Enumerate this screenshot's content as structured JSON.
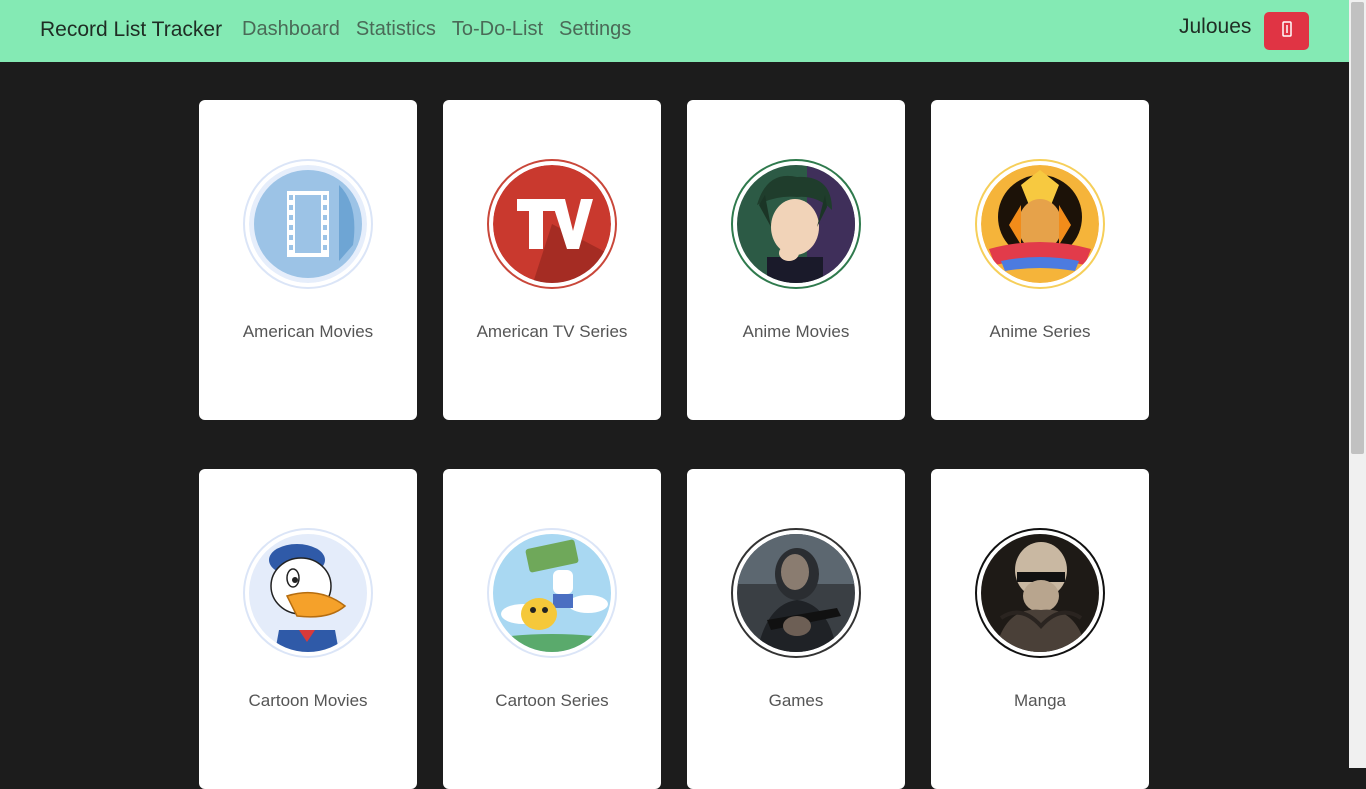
{
  "navbar": {
    "brand": "Record List Tracker",
    "links": [
      "Dashboard",
      "Statistics",
      "To-Do-List",
      "Settings"
    ],
    "username": "Juloues",
    "logout_icon": "logout-icon",
    "bg_color": "#84eab4",
    "logout_color": "#e03444"
  },
  "categories": [
    {
      "label": "American Movies",
      "icon": "film-reel-icon",
      "ring_color": "#dbe5f7"
    },
    {
      "label": "American TV Series",
      "icon": "tv-logo-icon",
      "ring_color": "#c9473a"
    },
    {
      "label": "Anime Movies",
      "icon": "anime-character-icon",
      "ring_color": "#2f7a4d"
    },
    {
      "label": "Anime Series",
      "icon": "naruto-logo-icon",
      "ring_color": "#f6cf5a"
    },
    {
      "label": "Cartoon Movies",
      "icon": "donald-duck-icon",
      "ring_color": "#dbe5f7"
    },
    {
      "label": "Cartoon Series",
      "icon": "adventure-time-icon",
      "ring_color": "#dbe5f7"
    },
    {
      "label": "Games",
      "icon": "soldier-game-icon",
      "ring_color": "#333333"
    },
    {
      "label": "Manga",
      "icon": "manga-character-icon",
      "ring_color": "#111111"
    }
  ]
}
